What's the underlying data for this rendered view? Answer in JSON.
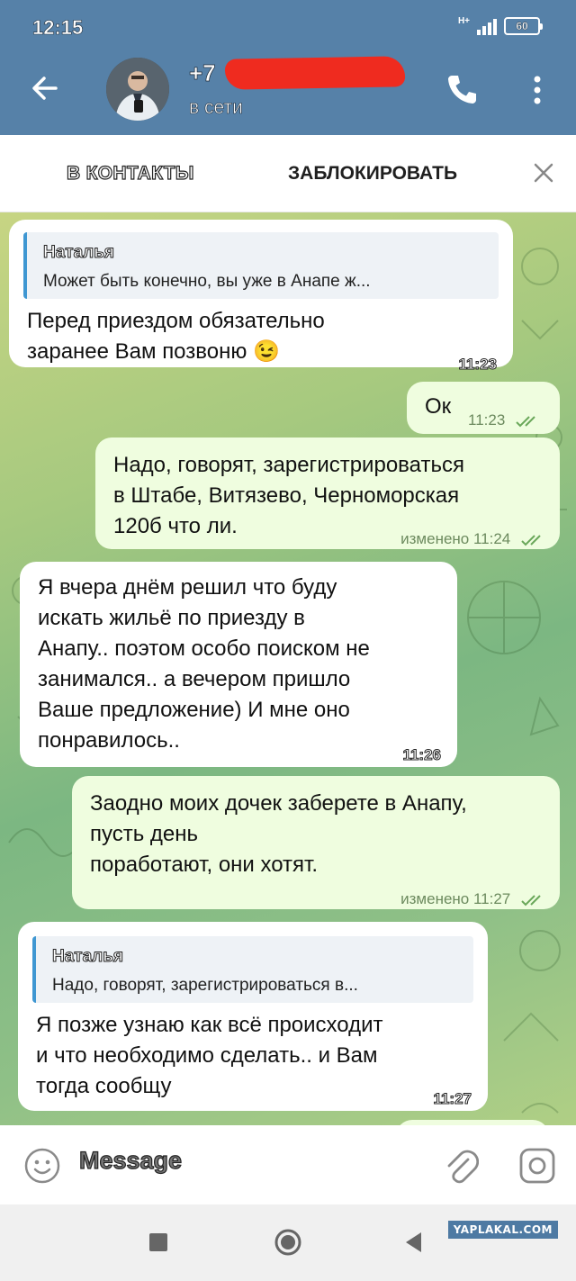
{
  "status": {
    "time": "12:15",
    "network": "H+",
    "battery": "60"
  },
  "header": {
    "name": "+7",
    "status": "в сети"
  },
  "actions": {
    "add_contact": "В КОНТАКТЫ",
    "block": "ЗАБЛОКИРОВАТЬ"
  },
  "messages": [
    {
      "reply_author": "Наталья",
      "reply_text": "Может быть конечно, вы уже в Анапе ж...",
      "text": "Перед приездом обязательно\nзаранее Вам позвоню 😉",
      "time": "11:23"
    },
    {
      "text": "Ок",
      "time": "11:23"
    },
    {
      "text": "Надо, говорят, зарегистрироваться\nв Штабе, Витязево, Черноморская\n120б что ли.",
      "time": "изменено 11:24"
    },
    {
      "text": "Я вчера днём решил что буду\nискать жильё по приезду в\nАнапу.. поэтом особо поиском не\nзанимался.. а вечером пришло\nВаше предложение) И мне оно\nпонравилось..",
      "time": "11:26"
    },
    {
      "text": "Заодно моих дочек заберете в Анапу,\nпусть день\nпоработают, они хотят.",
      "time": "изменено 11:27"
    },
    {
      "reply_author": "Наталья",
      "reply_text": "Надо, говорят, зарегистрироваться в...",
      "text": "Я позже узнаю как всё происходит\nи что необходимо сделать.. и Вам\nтогда сообщу",
      "time": "11:27"
    }
  ],
  "composer": {
    "placeholder": "Message"
  },
  "watermark": "YAPLAKAL.COM",
  "colors": {
    "header": "#5681a8",
    "outgoing": "#effddf",
    "incoming": "#ffffff",
    "reply_bar": "#3f97d2",
    "redaction": "#ef2b1f"
  }
}
